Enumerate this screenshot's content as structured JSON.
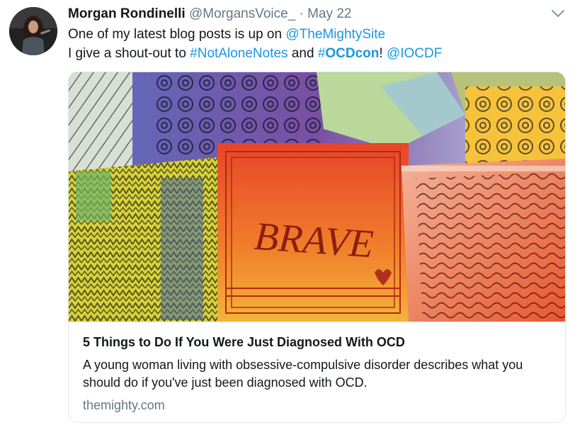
{
  "tweet": {
    "author_name": "Morgan Rondinelli",
    "author_handle": "@MorgansVoice_",
    "separator": "·",
    "date": "May 22",
    "line1_text": "One of my latest blog posts is up on ",
    "line1_mention": "@TheMightySite",
    "line2_prefix": "I give a shout-out to ",
    "line2_hashtag1": "#NotAloneNotes",
    "line2_and": " and ",
    "line2_hashtag2_hash": "#",
    "line2_hashtag2_bold": "OCDcon",
    "line2_excl": "! ",
    "line2_mention": "@IOCDF"
  },
  "card": {
    "image_text": "BRAVE",
    "title": "5 Things to Do If You Were Just Diagnosed With OCD",
    "description": "A young woman living with obsessive-compulsive disorder describes what you should do if you've just been diagnosed with OCD.",
    "domain": "themighty.com"
  },
  "colors": {
    "link": "#1b95e0",
    "secondary_text": "#657786",
    "border": "#e1e8ed"
  },
  "icons": [
    "avatar",
    "chevron-down-icon"
  ]
}
